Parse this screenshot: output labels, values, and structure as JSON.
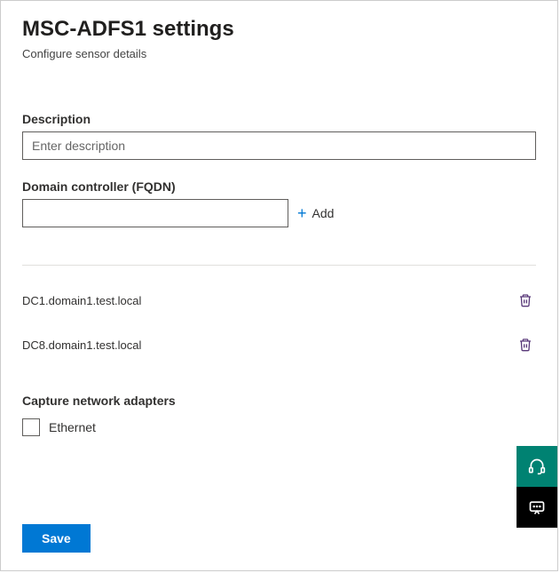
{
  "header": {
    "title": "MSC-ADFS1 settings",
    "subtitle": "Configure sensor details"
  },
  "description": {
    "label": "Description",
    "placeholder": "Enter description",
    "value": ""
  },
  "domain_controller": {
    "label": "Domain controller (FQDN)",
    "value": "",
    "add_label": "Add",
    "items": [
      {
        "name": "DC1.domain1.test.local"
      },
      {
        "name": "DC8.domain1.test.local"
      }
    ]
  },
  "adapters": {
    "label": "Capture network adapters",
    "options": [
      {
        "label": "Ethernet",
        "checked": false
      }
    ]
  },
  "actions": {
    "save": "Save"
  }
}
